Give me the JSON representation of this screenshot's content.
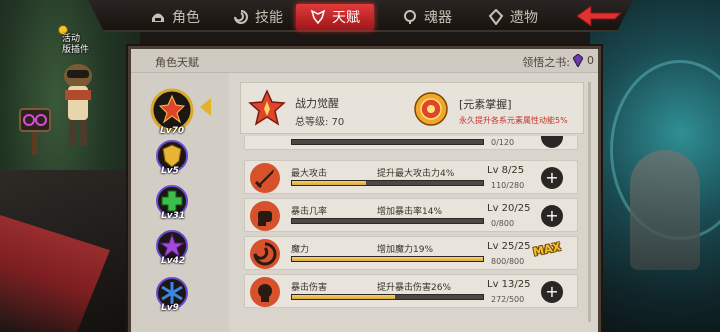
{
  "tabs": [
    {
      "label": "角色",
      "icon": "helmet-icon",
      "active": false
    },
    {
      "label": "技能",
      "icon": "swirl-icon",
      "active": false
    },
    {
      "label": "天赋",
      "icon": "wings-icon",
      "active": true
    },
    {
      "label": "魂器",
      "icon": "soul-orb-icon",
      "active": false
    },
    {
      "label": "遗物",
      "icon": "relic-icon",
      "active": false
    }
  ],
  "activity": {
    "line1": "活动",
    "line2": "版插件"
  },
  "panel": {
    "title": "角色天赋",
    "book_label": "领悟之书:",
    "book_count": "0"
  },
  "nodes": [
    {
      "level": "Lv70",
      "color": "#e0452b",
      "ring": "#d8a92a",
      "icon": "flame-crest-icon"
    },
    {
      "level": "Lv5",
      "color": "#e9b335",
      "ring": "#6b4ad1",
      "icon": "shield-crest-icon"
    },
    {
      "level": "Lv31",
      "color": "#3dbd4a",
      "ring": "#6b4ad1",
      "icon": "cross-crest-icon"
    },
    {
      "level": "Lv42",
      "color": "#a24ad6",
      "ring": "#6b4ad1",
      "icon": "star-crest-icon"
    },
    {
      "level": "Lv9",
      "color": "#3a86e0",
      "ring": "#6b4ad1",
      "icon": "snowflake-crest-icon"
    }
  ],
  "summary": {
    "name": "战力觉醒",
    "level_text": "总等级: 70",
    "element_title": "[元素掌握]",
    "element_desc": "永久提升各系元素属性动能5%"
  },
  "partial_row": {
    "xp": "0/120",
    "progress": 0
  },
  "rows": [
    {
      "name": "最大攻击",
      "effect": "提升最大攻击力4%",
      "lv": "Lv 8/25",
      "xp": "110/280",
      "progress": 0.39,
      "max": false,
      "icon": "sword-icon"
    },
    {
      "name": "暴击几率",
      "effect": "增加暴击率14%",
      "lv": "Lv 20/25",
      "xp": "0/800",
      "progress": 0,
      "max": false,
      "icon": "fist-icon"
    },
    {
      "name": "魔力",
      "effect": "增加魔力19%",
      "lv": "Lv 25/25",
      "xp": "800/800",
      "progress": 1,
      "max": true,
      "max_label": "MAX",
      "icon": "magic-swirl-icon"
    },
    {
      "name": "暴击伤害",
      "effect": "提升暴击伤害26%",
      "lv": "Lv 13/25",
      "xp": "272/500",
      "progress": 0.54,
      "max": false,
      "icon": "skull-burst-icon"
    }
  ],
  "plus_label": "+"
}
